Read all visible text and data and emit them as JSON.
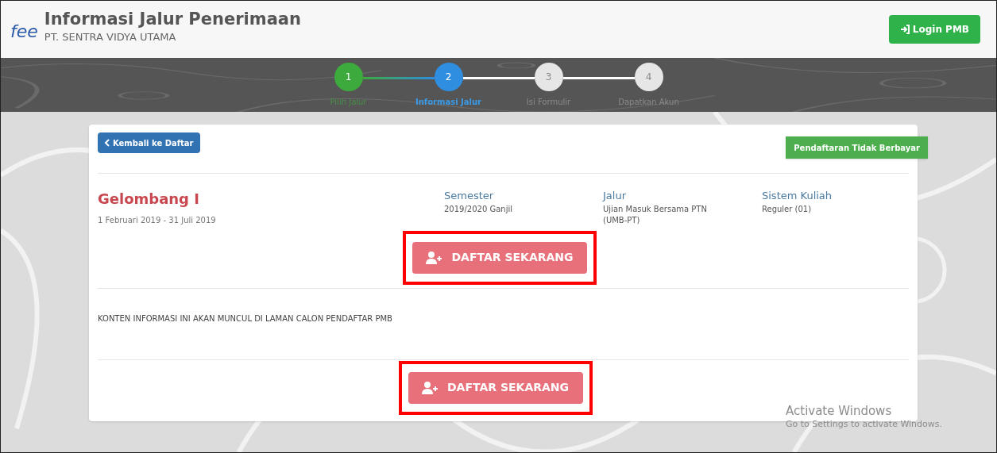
{
  "header": {
    "logo": "fee",
    "title": "Informasi Jalur Penerimaan",
    "subtitle": "PT. SENTRA VIDYA UTAMA",
    "login_button": "Login PMB"
  },
  "steps": [
    {
      "number": "1",
      "label": "Pilih Jalur",
      "completed": true,
      "selected": false
    },
    {
      "number": "2",
      "label": "Informasi Jalur",
      "completed": false,
      "selected": true
    },
    {
      "number": "3",
      "label": "Isi Formulir",
      "completed": false,
      "selected": false
    },
    {
      "number": "4",
      "label": "Dapatkan Akun",
      "completed": false,
      "selected": false
    }
  ],
  "card": {
    "back_button": "Kembali ke Daftar",
    "badge": "Pendaftaran Tidak Berbayar",
    "wave": {
      "title": "Gelombang I",
      "dates": "1 Februari 2019 - 31 Juli 2019"
    },
    "details": [
      {
        "label": "Semester",
        "value": "2019/2020 Ganjil"
      },
      {
        "label": "Jalur",
        "value": "Ujian Masuk Bersama PTN (UMB-PT)"
      },
      {
        "label": "Sistem Kuliah",
        "value": "Reguler (01)"
      }
    ],
    "register_buttons": [
      {
        "label": "DAFTAR SEKARANG",
        "highlighted": true
      },
      {
        "label": "DAFTAR SEKARANG",
        "highlighted": true
      }
    ],
    "info_text": "KONTEN INFORMASI INI AKAN MUNCUL DI LAMAN CALON PENDAFTAR PMB"
  },
  "activation_notice": {
    "title": "Activate Windows",
    "text": "Go to Settings to activate Windows."
  }
}
